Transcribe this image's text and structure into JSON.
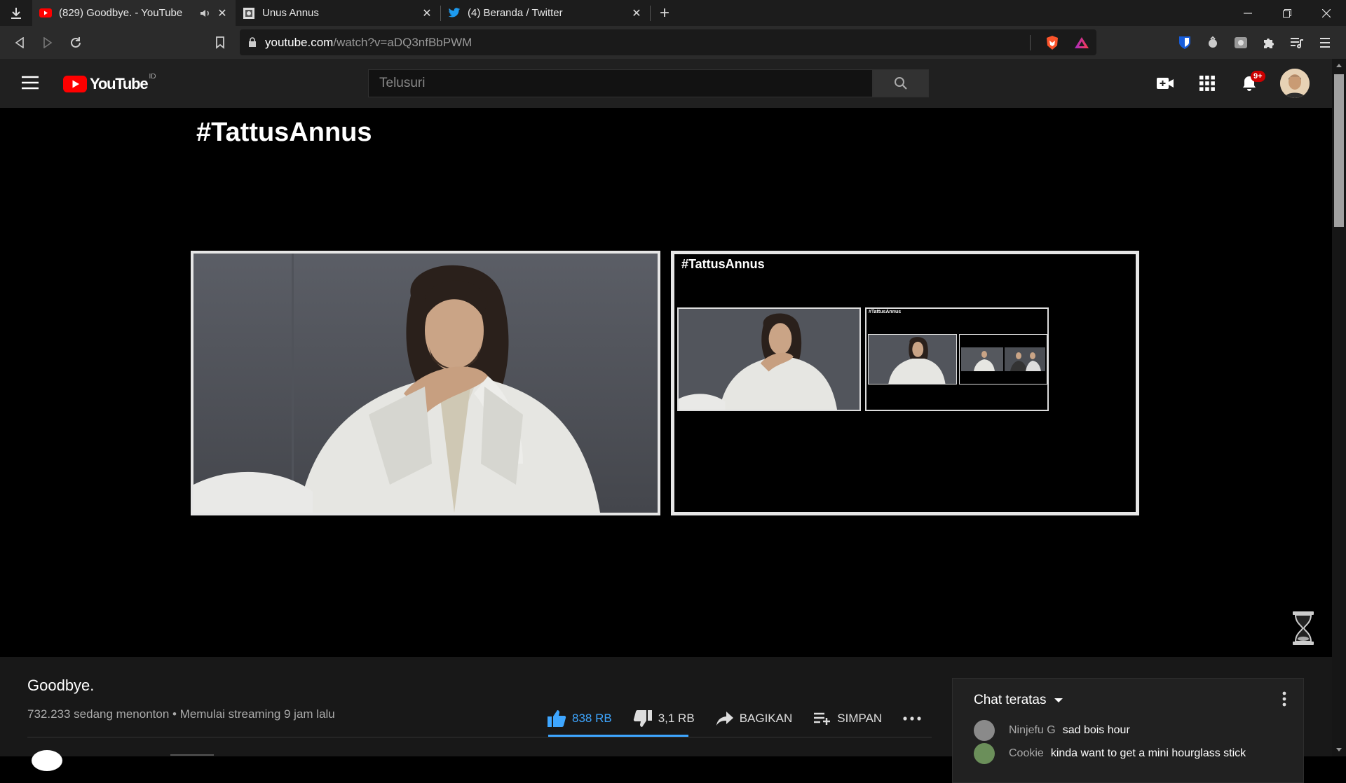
{
  "browser": {
    "tabs": [
      {
        "title": "(829) Goodbye. - YouTube",
        "favicon": "youtube-icon",
        "active": true,
        "audio": true
      },
      {
        "title": "Unus Annus",
        "favicon": "unus-annus-icon",
        "active": false
      },
      {
        "title": "(4) Beranda / Twitter",
        "favicon": "twitter-icon",
        "active": false
      }
    ],
    "address": {
      "host": "youtube.com",
      "path": "/watch?v=aDQ3nfBbPWM"
    }
  },
  "masthead": {
    "logo_text": "YouTube",
    "country_code": "ID",
    "search_placeholder": "Telusuri",
    "notification_count": "9+"
  },
  "player": {
    "overlay_title": "#TattusAnnus",
    "nested_title": "#TattusAnnus"
  },
  "video": {
    "title": "Goodbye.",
    "meta": "732.233 sedang menonton • Memulai streaming 9 jam lalu",
    "likes": "838 RB",
    "dislikes": "3,1 RB",
    "share_label": "BAGIKAN",
    "save_label": "SIMPAN",
    "like_ratio": 0.996
  },
  "chat": {
    "header": "Chat teratas",
    "messages": [
      {
        "author": "Ninjefu G",
        "text": "sad bois hour"
      },
      {
        "author": "Cookie",
        "text": "kinda want to get a mini hourglass stick"
      }
    ]
  },
  "colors": {
    "accent_blue": "#3ea6ff",
    "youtube_red": "#ff0000",
    "badge_red": "#cc0000",
    "background": "#000000"
  }
}
